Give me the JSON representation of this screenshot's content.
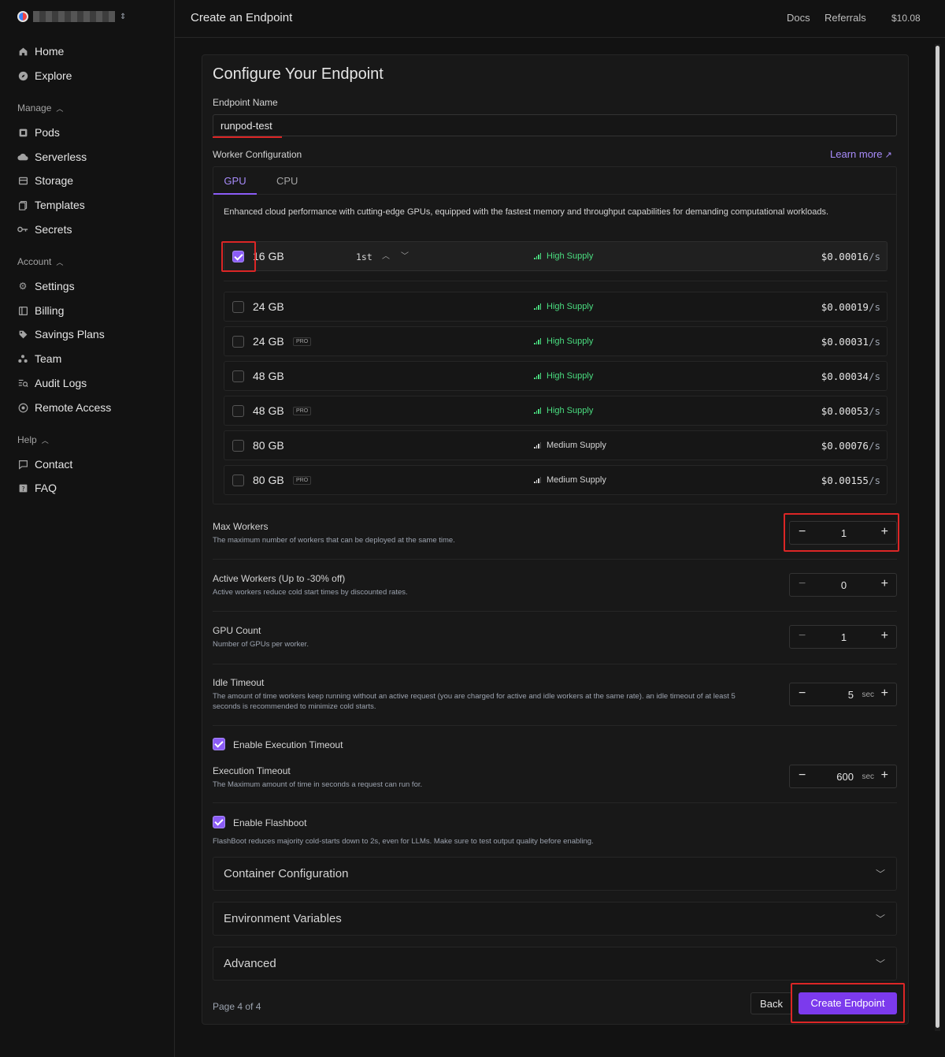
{
  "sidebar": {
    "sections": [
      "Manage",
      "Account",
      "Help"
    ],
    "top_items": [
      {
        "label": "Home",
        "icon": "home-icon"
      },
      {
        "label": "Explore",
        "icon": "compass-icon"
      }
    ],
    "manage_items": [
      {
        "label": "Pods",
        "icon": "pods-icon"
      },
      {
        "label": "Serverless",
        "icon": "cloud-icon"
      },
      {
        "label": "Storage",
        "icon": "storage-icon"
      },
      {
        "label": "Templates",
        "icon": "templates-icon"
      },
      {
        "label": "Secrets",
        "icon": "key-icon"
      }
    ],
    "account_items": [
      {
        "label": "Settings",
        "icon": "gear-icon"
      },
      {
        "label": "Billing",
        "icon": "billing-icon"
      },
      {
        "label": "Savings Plans",
        "icon": "tag-icon"
      },
      {
        "label": "Team",
        "icon": "team-icon"
      },
      {
        "label": "Audit Logs",
        "icon": "audit-icon"
      },
      {
        "label": "Remote Access",
        "icon": "remote-icon"
      }
    ],
    "help_items": [
      {
        "label": "Contact",
        "icon": "chat-icon"
      },
      {
        "label": "FAQ",
        "icon": "faq-icon"
      }
    ]
  },
  "header": {
    "title": "Create an Endpoint",
    "links": [
      "Docs",
      "Referrals"
    ],
    "balance": "$10.08"
  },
  "form": {
    "title": "Configure Your Endpoint",
    "endpoint_name_label": "Endpoint Name",
    "endpoint_name_value": "runpod-test",
    "worker_config_label": "Worker Configuration",
    "learn_more": "Learn more",
    "tabs": [
      "GPU",
      "CPU"
    ],
    "gpu_description": "Enhanced cloud performance with cutting-edge GPUs, equipped with the fastest memory and throughput capabilities for demanding computational workloads.",
    "gpu_options": [
      {
        "memory": "16 GB",
        "pro": false,
        "supply": "High Supply",
        "price": "$0.00016",
        "unit": "/s",
        "selected": true,
        "priority": "1st"
      },
      {
        "memory": "24 GB",
        "pro": false,
        "supply": "High Supply",
        "price": "$0.00019",
        "unit": "/s",
        "selected": false
      },
      {
        "memory": "24 GB",
        "pro": true,
        "supply": "High Supply",
        "price": "$0.00031",
        "unit": "/s",
        "selected": false
      },
      {
        "memory": "48 GB",
        "pro": false,
        "supply": "High Supply",
        "price": "$0.00034",
        "unit": "/s",
        "selected": false
      },
      {
        "memory": "48 GB",
        "pro": true,
        "supply": "High Supply",
        "price": "$0.00053",
        "unit": "/s",
        "selected": false
      },
      {
        "memory": "80 GB",
        "pro": false,
        "supply": "Medium Supply",
        "price": "$0.00076",
        "unit": "/s",
        "selected": false
      },
      {
        "memory": "80 GB",
        "pro": true,
        "supply": "Medium Supply",
        "price": "$0.00155",
        "unit": "/s",
        "selected": false
      }
    ],
    "pro_badge": "PRO",
    "colors": {
      "high_supply": "#4ade80",
      "medium_supply": "#d4d4d4",
      "accent": "#8b5cf6",
      "highlight": "#dc2626"
    },
    "max_workers": {
      "label": "Max Workers",
      "desc": "The maximum number of workers that can be deployed at the same time.",
      "value": "1"
    },
    "active_workers": {
      "label": "Active Workers (Up to -30% off)",
      "desc": "Active workers reduce cold start times by discounted rates.",
      "value": "0"
    },
    "gpu_count": {
      "label": "GPU Count",
      "desc": "Number of GPUs per worker.",
      "value": "1"
    },
    "idle_timeout": {
      "label": "Idle Timeout",
      "desc": "The amount of time workers keep running without an active request (you are charged for active and idle workers at the same rate). an idle timeout of at least 5 seconds is recommended to minimize cold starts.",
      "value": "5",
      "unit": "sec"
    },
    "enable_exec_timeout": {
      "label": "Enable Execution Timeout",
      "checked": true
    },
    "exec_timeout": {
      "label": "Execution Timeout",
      "desc": "The Maximum amount of time in seconds a request can run for.",
      "value": "600",
      "unit": "sec"
    },
    "flashboot": {
      "label": "Enable Flashboot",
      "checked": true,
      "desc": "FlashBoot reduces majority cold-starts down to 2s, even for LLMs. Make sure to test output quality before enabling."
    },
    "accordions": [
      "Container Configuration",
      "Environment Variables",
      "Advanced"
    ],
    "page_indicator": "Page 4 of 4",
    "back_label": "Back",
    "create_label": "Create Endpoint"
  }
}
